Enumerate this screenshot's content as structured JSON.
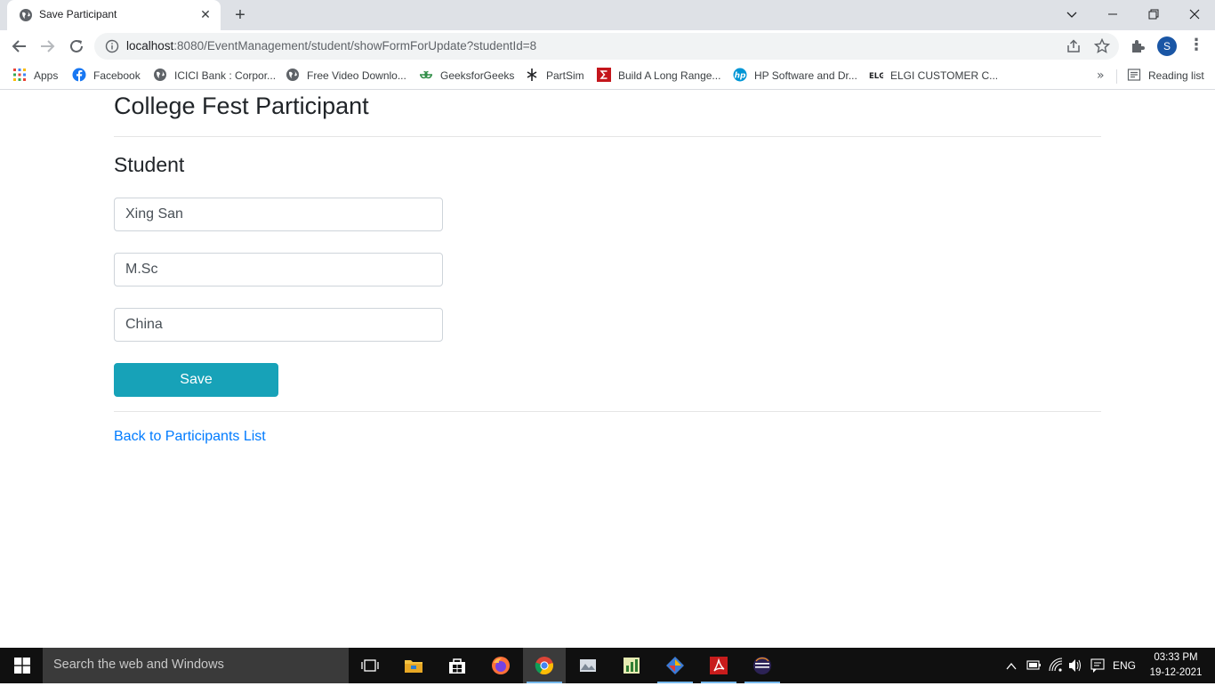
{
  "browser": {
    "tab_title": "Save Participant",
    "tab_close": "✕",
    "new_tab": "+",
    "url_host": "localhost",
    "url_rest": ":8080/EventManagement/student/showFormForUpdate?studentId=8",
    "avatar_letter": "S"
  },
  "bookmarks": {
    "items": [
      {
        "label": "Apps",
        "icon": "apps-grid-icon"
      },
      {
        "label": "Facebook",
        "icon": "facebook-icon"
      },
      {
        "label": "ICICI Bank : Corpor...",
        "icon": "globe-icon"
      },
      {
        "label": "Free Video Downlo...",
        "icon": "globe-icon"
      },
      {
        "label": "GeeksforGeeks",
        "icon": "geeksforgeeks-icon"
      },
      {
        "label": "PartSim",
        "icon": "partsim-icon"
      },
      {
        "label": "Build A Long Range...",
        "icon": "sigma-icon"
      },
      {
        "label": "HP Software and Dr...",
        "icon": "hp-icon"
      },
      {
        "label": "ELGI CUSTOMER C...",
        "icon": "elgi-icon"
      }
    ],
    "more": "»",
    "reading_list": "Reading list"
  },
  "page": {
    "title": "College Fest Participant",
    "section": "Student",
    "fields": {
      "name": "Xing San",
      "course": "M.Sc",
      "country": "China"
    },
    "save_label": "Save",
    "back_link": "Back to Participants List"
  },
  "taskbar": {
    "search_placeholder": "Search the web and Windows",
    "language": "ENG",
    "time": "03:33 PM",
    "date": "19-12-2021"
  },
  "colors": {
    "accent_button": "#17a2b8",
    "link": "#007bff",
    "avatar": "#1a56a5"
  }
}
